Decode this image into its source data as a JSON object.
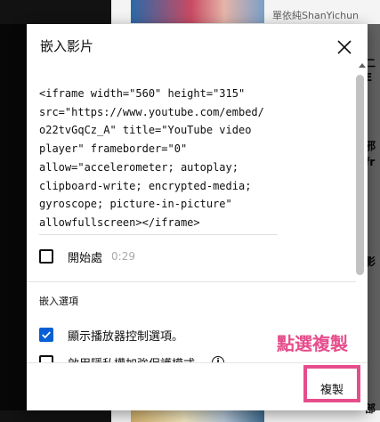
{
  "background": {
    "channel_name": "單依純ShanYichun",
    "fragments": [
      "二",
      "E",
      "邪",
      "fr",
      "影",
      "部"
    ]
  },
  "dialog": {
    "title": "嵌入影片",
    "embed_code_lines": [
      "<iframe width=\"560\" height=\"315\"",
      "src=\"https://www.youtube.com/embed/",
      "o22tvGqCz_A\" title=\"YouTube video",
      "player\" frameborder=\"0\"",
      "allow=\"accelerometer; autoplay;",
      "clipboard-write; encrypted-media;",
      "gyroscope; picture-in-picture\"",
      "allowfullscreen></iframe>"
    ],
    "start_at_label": "開始處",
    "start_at_time": "0:29",
    "start_at_checked": false,
    "embed_options_label": "嵌入選項",
    "options": [
      {
        "label": "顯示播放器控制選項。",
        "checked": true
      },
      {
        "label": "啟用隱私權加強保護模式。",
        "checked": false
      }
    ],
    "copy_button_label": "複製"
  },
  "annotation": {
    "text": "點選複製",
    "color": "#e64d8c"
  },
  "colors": {
    "checkbox_accent": "#065fd4"
  }
}
